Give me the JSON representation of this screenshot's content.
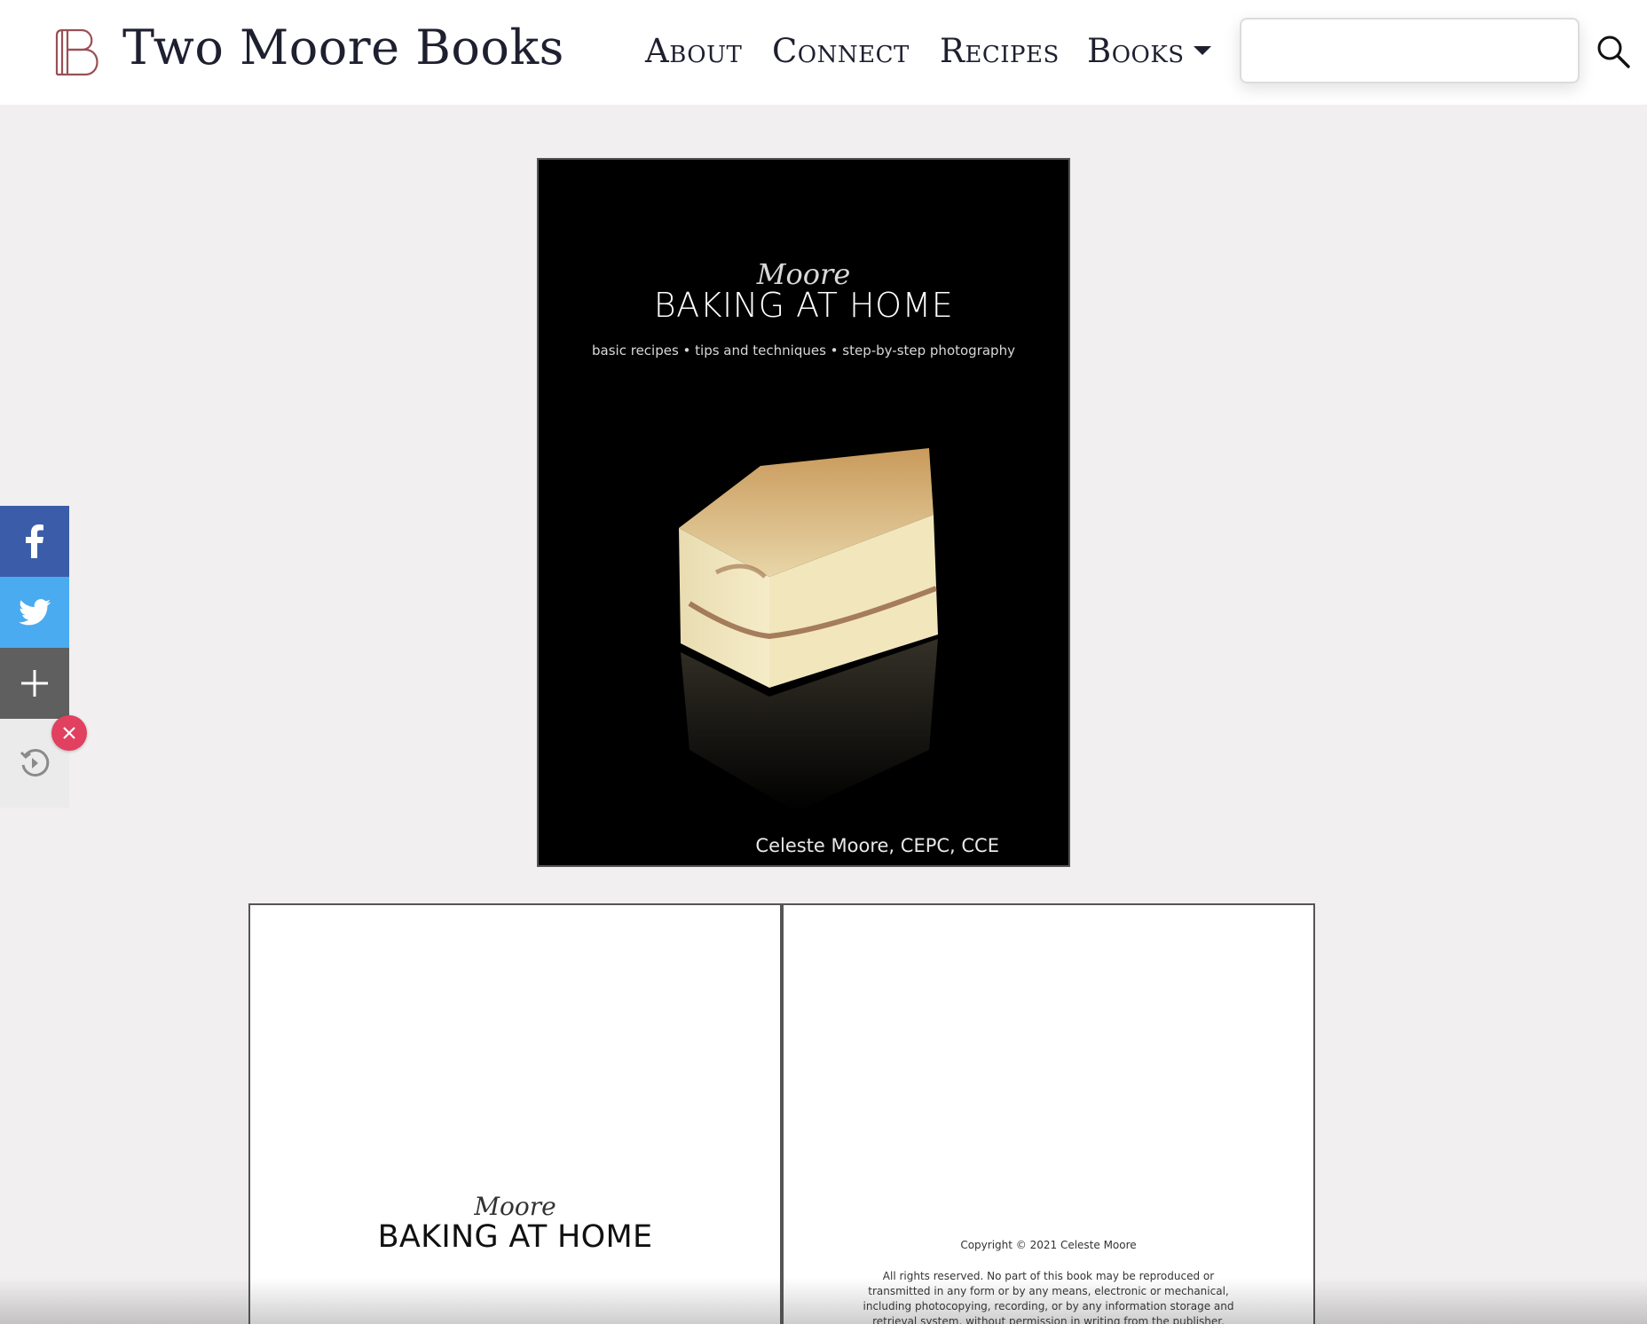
{
  "header": {
    "brand": "Two Moore Books",
    "nav": [
      {
        "label": "About"
      },
      {
        "label": "Connect"
      },
      {
        "label": "Recipes"
      },
      {
        "label": "Books"
      }
    ],
    "search": {
      "value": "",
      "placeholder": ""
    }
  },
  "cover": {
    "script_title": "Moore",
    "title": "BAKING AT HOME",
    "subtitle": "basic recipes • tips and techniques • step-by-step photography",
    "author": "Celeste Moore, CEPC, CCE"
  },
  "spread": {
    "left": {
      "script_title": "Moore",
      "title": "BAKING AT HOME"
    },
    "right": {
      "copyright": "Copyright © 2021 Celeste Moore",
      "rights": "All rights reserved. No part of this book may be reproduced or transmitted in any form or by any means, electronic or mechanical, including photocopying, recording, or by any information storage and retrieval system, without permission in writing from the publisher."
    }
  },
  "share": {
    "buttons": [
      {
        "icon": "facebook-icon",
        "color": "#3b5da9"
      },
      {
        "icon": "twitter-icon",
        "color": "#4aabf0"
      },
      {
        "icon": "plus-icon",
        "color": "#5f5f5f"
      }
    ],
    "close_color": "#e1405f"
  }
}
